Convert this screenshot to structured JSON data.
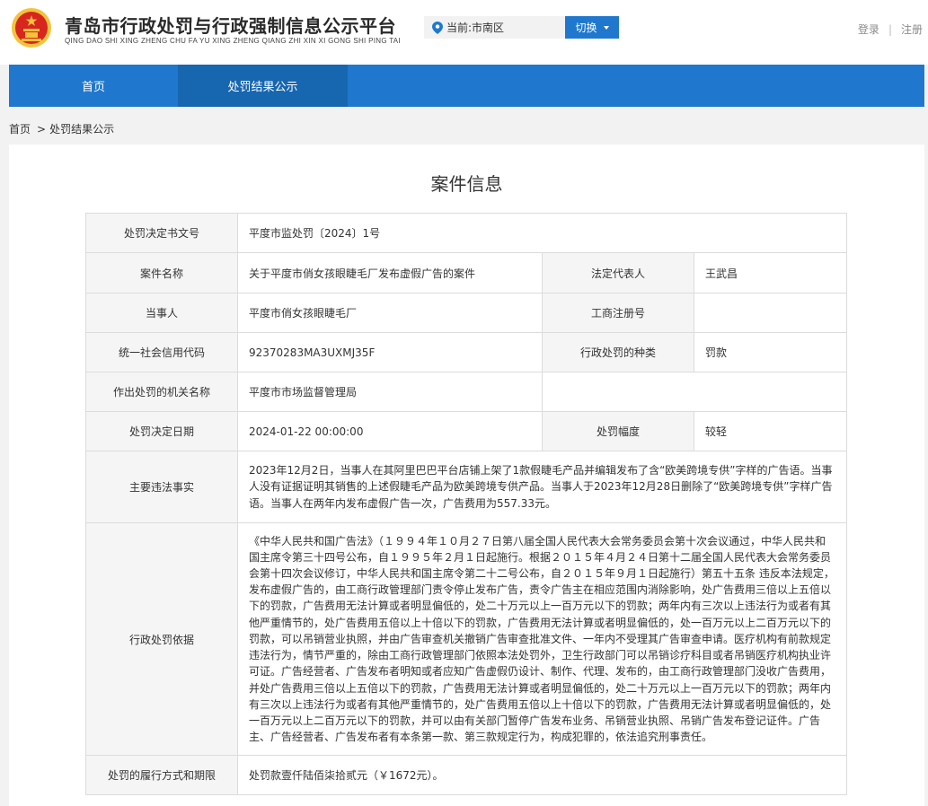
{
  "header": {
    "title": "青岛市行政处罚与行政强制信息公示平台",
    "subtitle": "QING DAO SHI XING ZHENG CHU FA YU XING ZHENG QIANG ZHI XIN XI GONG SHI PING TAI",
    "location_label": "当前:市南区",
    "switch_label": "切换",
    "login_label": "登录",
    "separator": "|",
    "register_label": "注册"
  },
  "nav": {
    "items": [
      {
        "label": "首页"
      },
      {
        "label": "处罚结果公示"
      }
    ]
  },
  "breadcrumb": {
    "home": "首页",
    "arrow": ">",
    "current": "处罚结果公示"
  },
  "case": {
    "title": "案件信息",
    "decision_no_label": "处罚决定书文号",
    "decision_no": "平度市监处罚〔2024〕1号",
    "case_name_label": "案件名称",
    "case_name": "关于平度市俏女孩眼睫毛厂发布虚假广告的案件",
    "legal_rep_label": "法定代表人",
    "legal_rep": "王武昌",
    "party_label": "当事人",
    "party": "平度市俏女孩眼睫毛厂",
    "reg_no_label": "工商注册号",
    "reg_no": "",
    "credit_code_label": "统一社会信用代码",
    "credit_code": "92370283MA3UXMJ35F",
    "penalty_type_label": "行政处罚的种类",
    "penalty_type": "罚款",
    "authority_label": "作出处罚的机关名称",
    "authority": "平度市市场监督管理局",
    "decision_date_label": "处罚决定日期",
    "decision_date": "2024-01-22 00:00:00",
    "penalty_range_label": "处罚幅度",
    "penalty_range": "较轻",
    "facts_label": "主要违法事实",
    "facts": "2023年12月2日，当事人在其阿里巴巴平台店铺上架了1款假睫毛产品并编辑发布了含“欧美跨境专供”字样的广告语。当事人没有证据证明其销售的上述假睫毛产品为欧美跨境专供产品。当事人于2023年12月28日删除了“欧美跨境专供”字样广告语。当事人在两年内发布虚假广告一次，广告费用为557.33元。",
    "basis_label": "行政处罚依据",
    "basis": "《中华人民共和国广告法》（１９９４年１０月２７日第八届全国人民代表大会常务委员会第十次会议通过，中华人民共和国主席令第三十四号公布，自１９９５年２月１日起施行。根据２０１５年４月２４日第十二届全国人民代表大会常务委员会第十四次会议修订，中华人民共和国主席令第二十二号公布，自２０１５年９月１日起施行）第五十五条 违反本法规定，发布虚假广告的，由工商行政管理部门责令停止发布广告，责令广告主在相应范围内消除影响，处广告费用三倍以上五倍以下的罚款，广告费用无法计算或者明显偏低的，处二十万元以上一百万元以下的罚款；两年内有三次以上违法行为或者有其他严重情节的，处广告费用五倍以上十倍以下的罚款，广告费用无法计算或者明显偏低的，处一百万元以上二百万元以下的罚款，可以吊销营业执照，并由广告审查机关撤销广告审查批准文件、一年内不受理其广告审查申请。医疗机构有前款规定违法行为，情节严重的，除由工商行政管理部门依照本法处罚外，卫生行政部门可以吊销诊疗科目或者吊销医疗机构执业许可证。广告经营者、广告发布者明知或者应知广告虚假仍设计、制作、代理、发布的，由工商行政管理部门没收广告费用，并处广告费用三倍以上五倍以下的罚款，广告费用无法计算或者明显偏低的，处二十万元以上一百万元以下的罚款；两年内有三次以上违法行为或者有其他严重情节的，处广告费用五倍以上十倍以下的罚款，广告费用无法计算或者明显偏低的，处一百万元以上二百万元以下的罚款，并可以由有关部门暂停广告发布业务、吊销营业执照、吊销广告发布登记证件。广告主、广告经营者、广告发布者有本条第一款、第三款规定行为，构成犯罪的，依法追究刑事责任。",
    "execution_label": "处罚的履行方式和期限",
    "execution": "处罚款壹仟陆佰柒拾贰元（￥1672元）。"
  },
  "colors": {
    "primary_blue": "#1f78cd",
    "active_nav": "#1766b0",
    "emblem_red": "#d7261e",
    "emblem_gold": "#f3c33b"
  },
  "icons": {
    "emblem": "national-emblem-icon",
    "location": "location-pin-icon",
    "dropdown": "caret-down-icon"
  }
}
